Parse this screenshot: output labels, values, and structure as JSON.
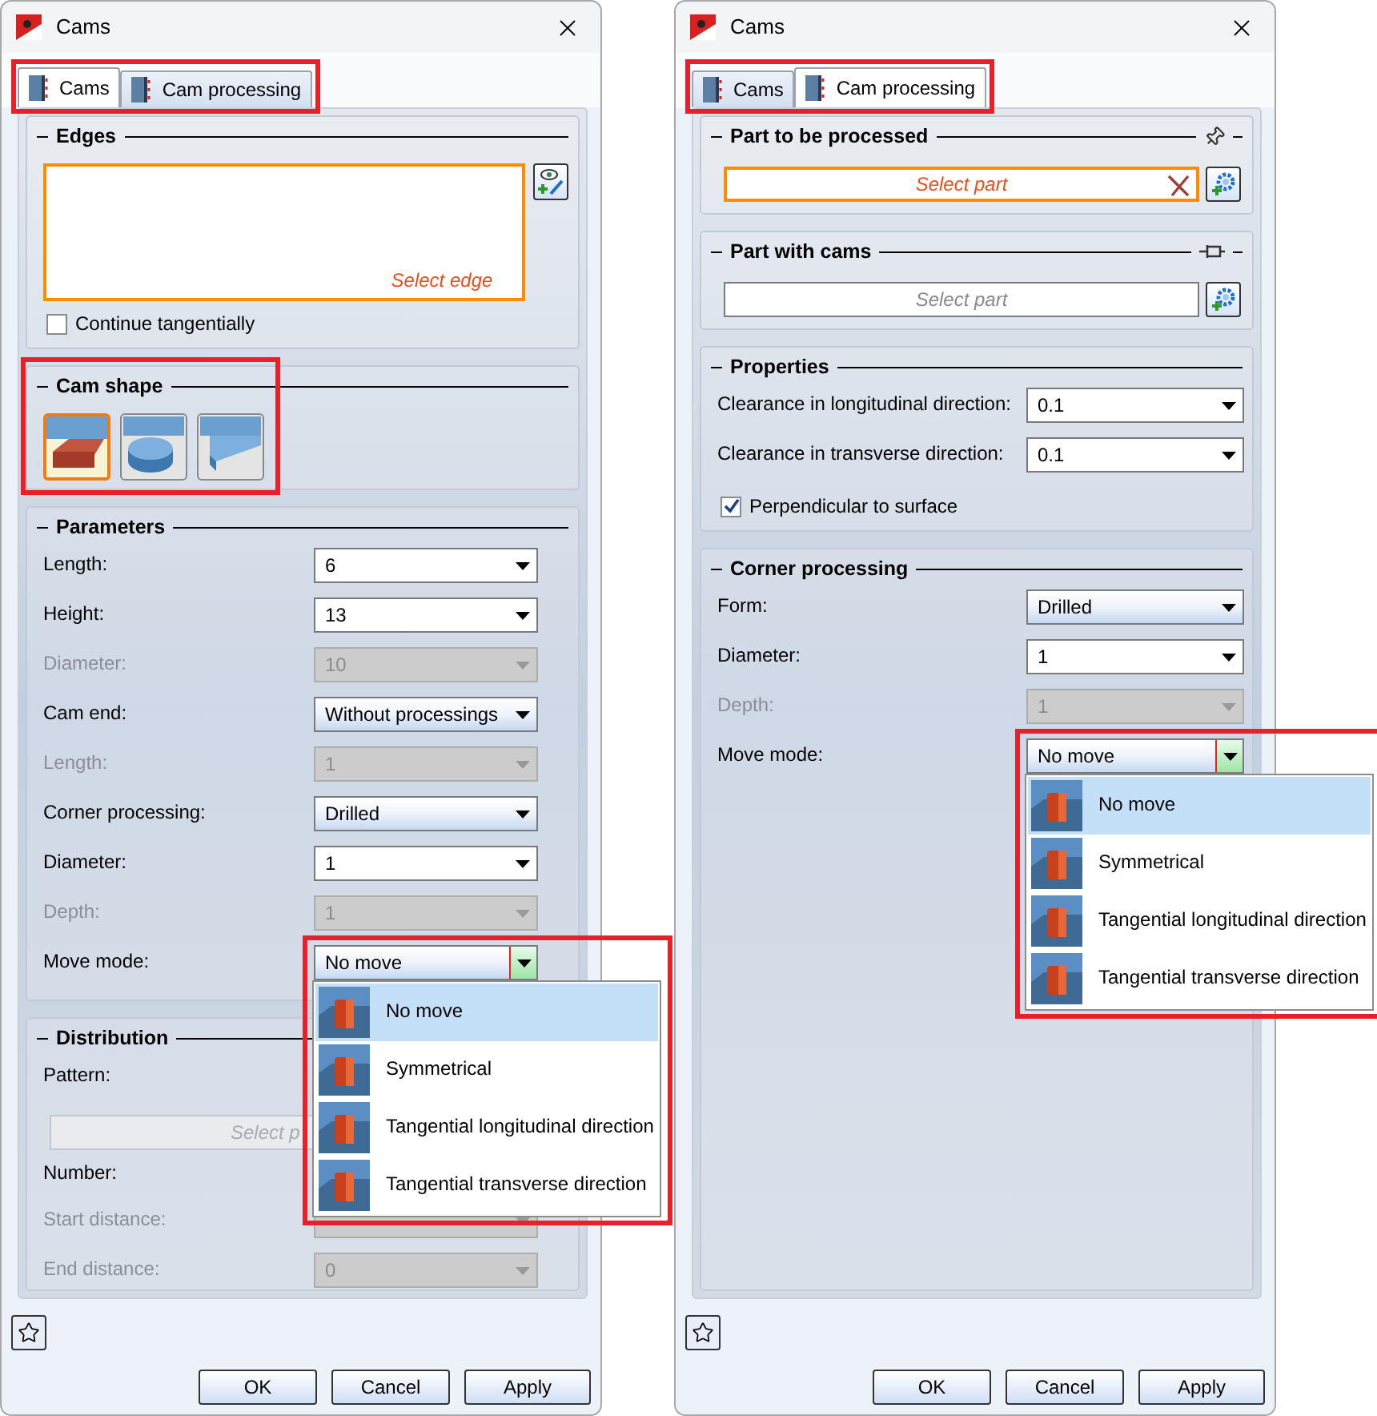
{
  "dialogs": [
    {
      "title": "Cams",
      "tabs_highlighted": true,
      "tabs": [
        {
          "label": "Cams",
          "selected": true
        },
        {
          "label": "Cam processing",
          "selected": false
        }
      ],
      "sections": [
        {
          "title": "Edges",
          "items": [
            {
              "kind": "edge_list",
              "placeholder": "Select edge",
              "active": true
            },
            {
              "kind": "checkbox",
              "label": "Continue tangentially",
              "checked": false
            }
          ]
        },
        {
          "title": "Cam shape",
          "highlighted": true,
          "items": [
            {
              "kind": "shapes",
              "options": [
                {
                  "kind": "block",
                  "selected": true
                },
                {
                  "kind": "disc",
                  "selected": false
                },
                {
                  "kind": "step",
                  "selected": false
                }
              ]
            }
          ]
        },
        {
          "title": "Parameters",
          "items": [
            {
              "kind": "combo",
              "label": "Length:",
              "value": "6",
              "disabled": false
            },
            {
              "kind": "combo",
              "label": "Height:",
              "value": "13",
              "disabled": false
            },
            {
              "kind": "combo",
              "label": "Diameter:",
              "value": "10",
              "disabled": true
            },
            {
              "kind": "dropdown",
              "label": "Cam end:",
              "value": "Without processings",
              "disabled": false
            },
            {
              "kind": "combo",
              "label": "Length:",
              "value": "1",
              "disabled": true
            },
            {
              "kind": "dropdown",
              "label": "Corner processing:",
              "value": "Drilled",
              "disabled": false
            },
            {
              "kind": "combo",
              "label": "Diameter:",
              "value": "1",
              "disabled": false
            },
            {
              "kind": "combo",
              "label": "Depth:",
              "value": "1",
              "disabled": true
            },
            {
              "kind": "dropdown",
              "label": "Move mode:",
              "value": "No move",
              "disabled": false,
              "open": true,
              "highlighted": true,
              "options": [
                {
                  "label": "No move",
                  "selected": true
                },
                {
                  "label": "Symmetrical",
                  "selected": false
                },
                {
                  "label": "Tangential longitudinal direction",
                  "selected": false
                },
                {
                  "label": "Tangential transverse direction",
                  "selected": false
                }
              ]
            }
          ]
        },
        {
          "title": "Distribution",
          "items": [
            {
              "kind": "label",
              "label": "Pattern:"
            },
            {
              "kind": "part_select",
              "placeholder": "Select p",
              "disabled": true
            },
            {
              "kind": "label",
              "label": "Number:"
            },
            {
              "kind": "combo",
              "label": "Start distance:",
              "disabled": true
            },
            {
              "kind": "combo",
              "label": "End distance:",
              "value": "0",
              "disabled": true
            }
          ]
        }
      ],
      "buttons": [
        "OK",
        "Cancel",
        "Apply"
      ]
    },
    {
      "title": "Cams",
      "tabs_highlighted": true,
      "tabs": [
        {
          "label": "Cams",
          "selected": false
        },
        {
          "label": "Cam processing",
          "selected": true
        }
      ],
      "sections": [
        {
          "title": "Part to be processed",
          "pinned": true,
          "items": [
            {
              "kind": "part_select",
              "placeholder": "Select part",
              "active": true,
              "disabled": false,
              "clearable": true
            }
          ]
        },
        {
          "title": "Part with cams",
          "pinned": false,
          "items": [
            {
              "kind": "part_select",
              "placeholder": "Select part",
              "active": false,
              "disabled": false,
              "clearable": false
            }
          ]
        },
        {
          "title": "Properties",
          "items": [
            {
              "kind": "combo",
              "label": "Clearance in longitudinal direction:",
              "value": "0.1",
              "disabled": false
            },
            {
              "kind": "combo",
              "label": "Clearance in transverse direction:",
              "value": "0.1",
              "disabled": false
            },
            {
              "kind": "checkbox",
              "label": "Perpendicular to surface",
              "checked": true
            }
          ]
        },
        {
          "title": "Corner processing",
          "items": [
            {
              "kind": "dropdown",
              "label": "Form:",
              "value": "Drilled",
              "disabled": false
            },
            {
              "kind": "combo",
              "label": "Diameter:",
              "value": "1",
              "disabled": false
            },
            {
              "kind": "combo",
              "label": "Depth:",
              "value": "1",
              "disabled": true
            },
            {
              "kind": "dropdown",
              "label": "Move mode:",
              "value": "No move",
              "disabled": false,
              "open": true,
              "highlighted": true,
              "options": [
                {
                  "label": "No move",
                  "selected": true
                },
                {
                  "label": "Symmetrical",
                  "selected": false
                },
                {
                  "label": "Tangential longitudinal direction",
                  "selected": false
                },
                {
                  "label": "Tangential transverse direction",
                  "selected": false
                }
              ]
            }
          ]
        }
      ],
      "buttons": [
        "OK",
        "Cancel",
        "Apply"
      ]
    }
  ]
}
